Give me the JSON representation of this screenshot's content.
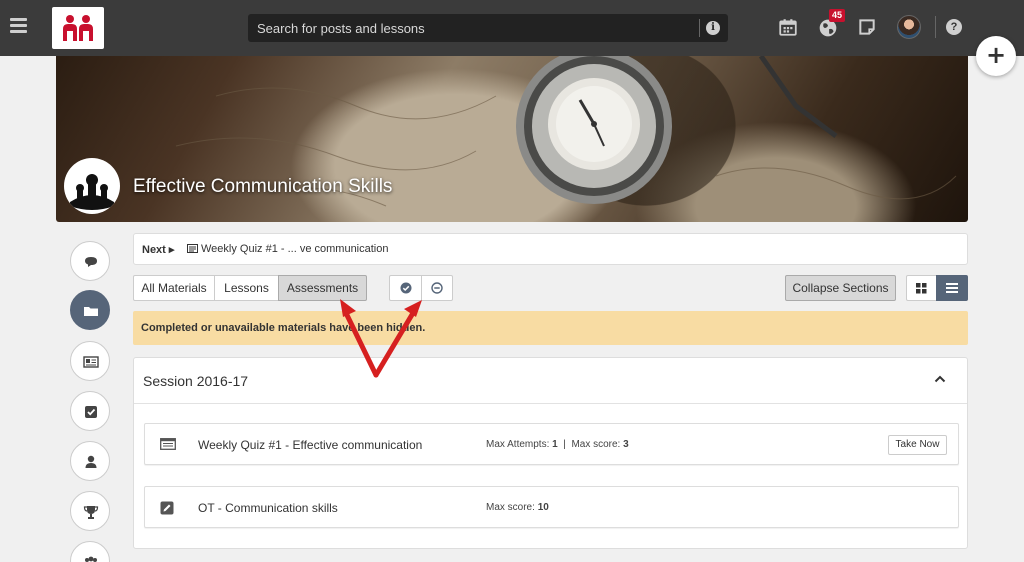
{
  "header": {
    "search_placeholder": "Search for posts and lessons",
    "notification_count": "45"
  },
  "course": {
    "title": "Effective Communication Skills"
  },
  "next_bar": {
    "label": "Next",
    "item": "Weekly Quiz #1 - ... ve communication"
  },
  "filters": {
    "tabs": [
      {
        "label": "All Materials"
      },
      {
        "label": "Lessons"
      },
      {
        "label": "Assessments",
        "active": true
      }
    ],
    "collapse_label": "Collapse Sections"
  },
  "alert": {
    "message": "Completed or unavailable materials have been hidden."
  },
  "session": {
    "title": "Session 2016-17",
    "items": [
      {
        "icon": "quiz-icon",
        "title": "Weekly Quiz #1 - Effective communication",
        "max_attempts_label": "Max Attempts:",
        "max_attempts": "1",
        "sep": "|",
        "max_score_label": "Max score:",
        "max_score": "3",
        "action": "Take Now"
      },
      {
        "icon": "pencil-icon",
        "title": "OT - Communication skills",
        "max_score_label": "Max score:",
        "max_score": "10"
      }
    ]
  },
  "colors": {
    "topbar": "#3b3b3b",
    "brand_red": "#c8102e",
    "rail_active": "#566579",
    "alert_bg": "#f8dca3",
    "annotation_arrow": "#d62020"
  }
}
